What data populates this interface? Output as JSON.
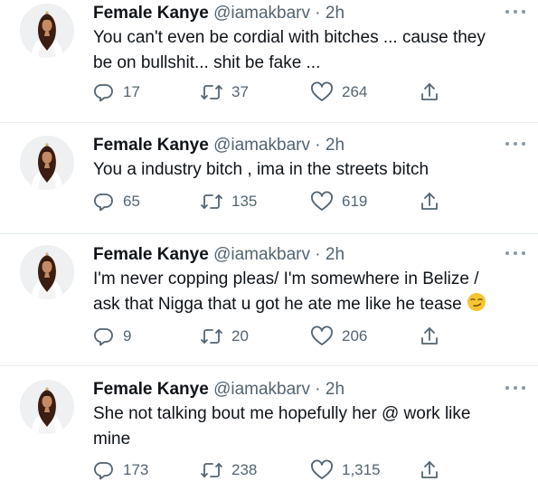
{
  "tweets": [
    {
      "name": "Female Kanye",
      "handle": "@iamakbarv",
      "separator": "·",
      "time": "2h",
      "line1": "You can't even be cordial with bitches ... cause they",
      "line2": "be on bullshit... shit be fake ...",
      "replies": "17",
      "retweets": "37",
      "likes": "264"
    },
    {
      "name": "Female Kanye",
      "handle": "@iamakbarv",
      "separator": "·",
      "time": "2h",
      "line1": "You a industry bitch , ima in the streets bitch",
      "replies": "65",
      "retweets": "135",
      "likes": "619"
    },
    {
      "name": "Female Kanye",
      "handle": "@iamakbarv",
      "separator": "·",
      "time": "2h",
      "line1": "I'm never copping pleas/ I'm somewhere in Belize /",
      "line2": "ask that Nigga that u got he ate me like he tease",
      "emoji": "smirking-face-emoji",
      "replies": "9",
      "retweets": "20",
      "likes": "206"
    },
    {
      "name": "Female Kanye",
      "handle": "@iamakbarv",
      "separator": "·",
      "time": "2h",
      "line1": "She not talking bout me hopefully her @ work like",
      "line2": "mine",
      "replies": "173",
      "retweets": "238",
      "likes": "1,315"
    }
  ],
  "icons": {
    "reply": "reply-icon",
    "retweet": "retweet-icon",
    "like": "heart-icon",
    "share": "share-icon",
    "more": "more-options-icon"
  },
  "colors": {
    "text": "#0f1419",
    "muted": "#536471",
    "divider": "#e6ecf0",
    "avatar_bg": "#eef0f1"
  }
}
